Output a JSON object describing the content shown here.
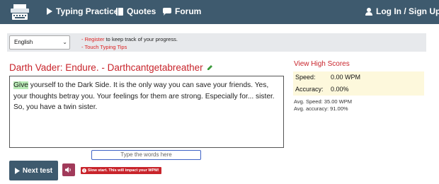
{
  "nav": {
    "typing_practice": "Typing Practice",
    "quotes": "Quotes",
    "forum": "Forum",
    "login": "Log In / Sign Up"
  },
  "options": {
    "language": "English",
    "register_link": "- Register",
    "register_rest": " to keep track of your progress.",
    "tips_link": "- Touch Typing Tips"
  },
  "quote": {
    "title": "Darth Vader: Endure. - Darthcantgetabreather",
    "current_word": "Give",
    "rest_text": " yourself to the Dark Side. It is the only way you can save your friends. Yes, your thoughts betray you. Your feelings for them are strong. Especially for... sister. So, you have a twin sister."
  },
  "input": {
    "placeholder": "Type the words here"
  },
  "controls": {
    "next_test": "Next test",
    "slow_start_warning": "Slow start. This will impact your WPM!"
  },
  "stats": {
    "view_high_scores": "View High Scores",
    "speed_label": "Speed:",
    "speed_value": "0.00 WPM",
    "accuracy_label": "Accuracy:",
    "accuracy_value": "0.00%",
    "avg_speed": "Avg. Speed: 35.00 WPM",
    "avg_accuracy": "Avg. accuracy: 91.00%"
  },
  "colors": {
    "navbar": "#3e5a6e",
    "accent_red": "#c8242b",
    "highlight_green": "#b9ecb6",
    "stats_bg": "#fdf8dc"
  },
  "icons": [
    "typewriter-logo-icon",
    "play-icon",
    "book-icon",
    "chat-icon",
    "user-icon",
    "pencil-icon",
    "volume-icon",
    "alert-icon"
  ]
}
